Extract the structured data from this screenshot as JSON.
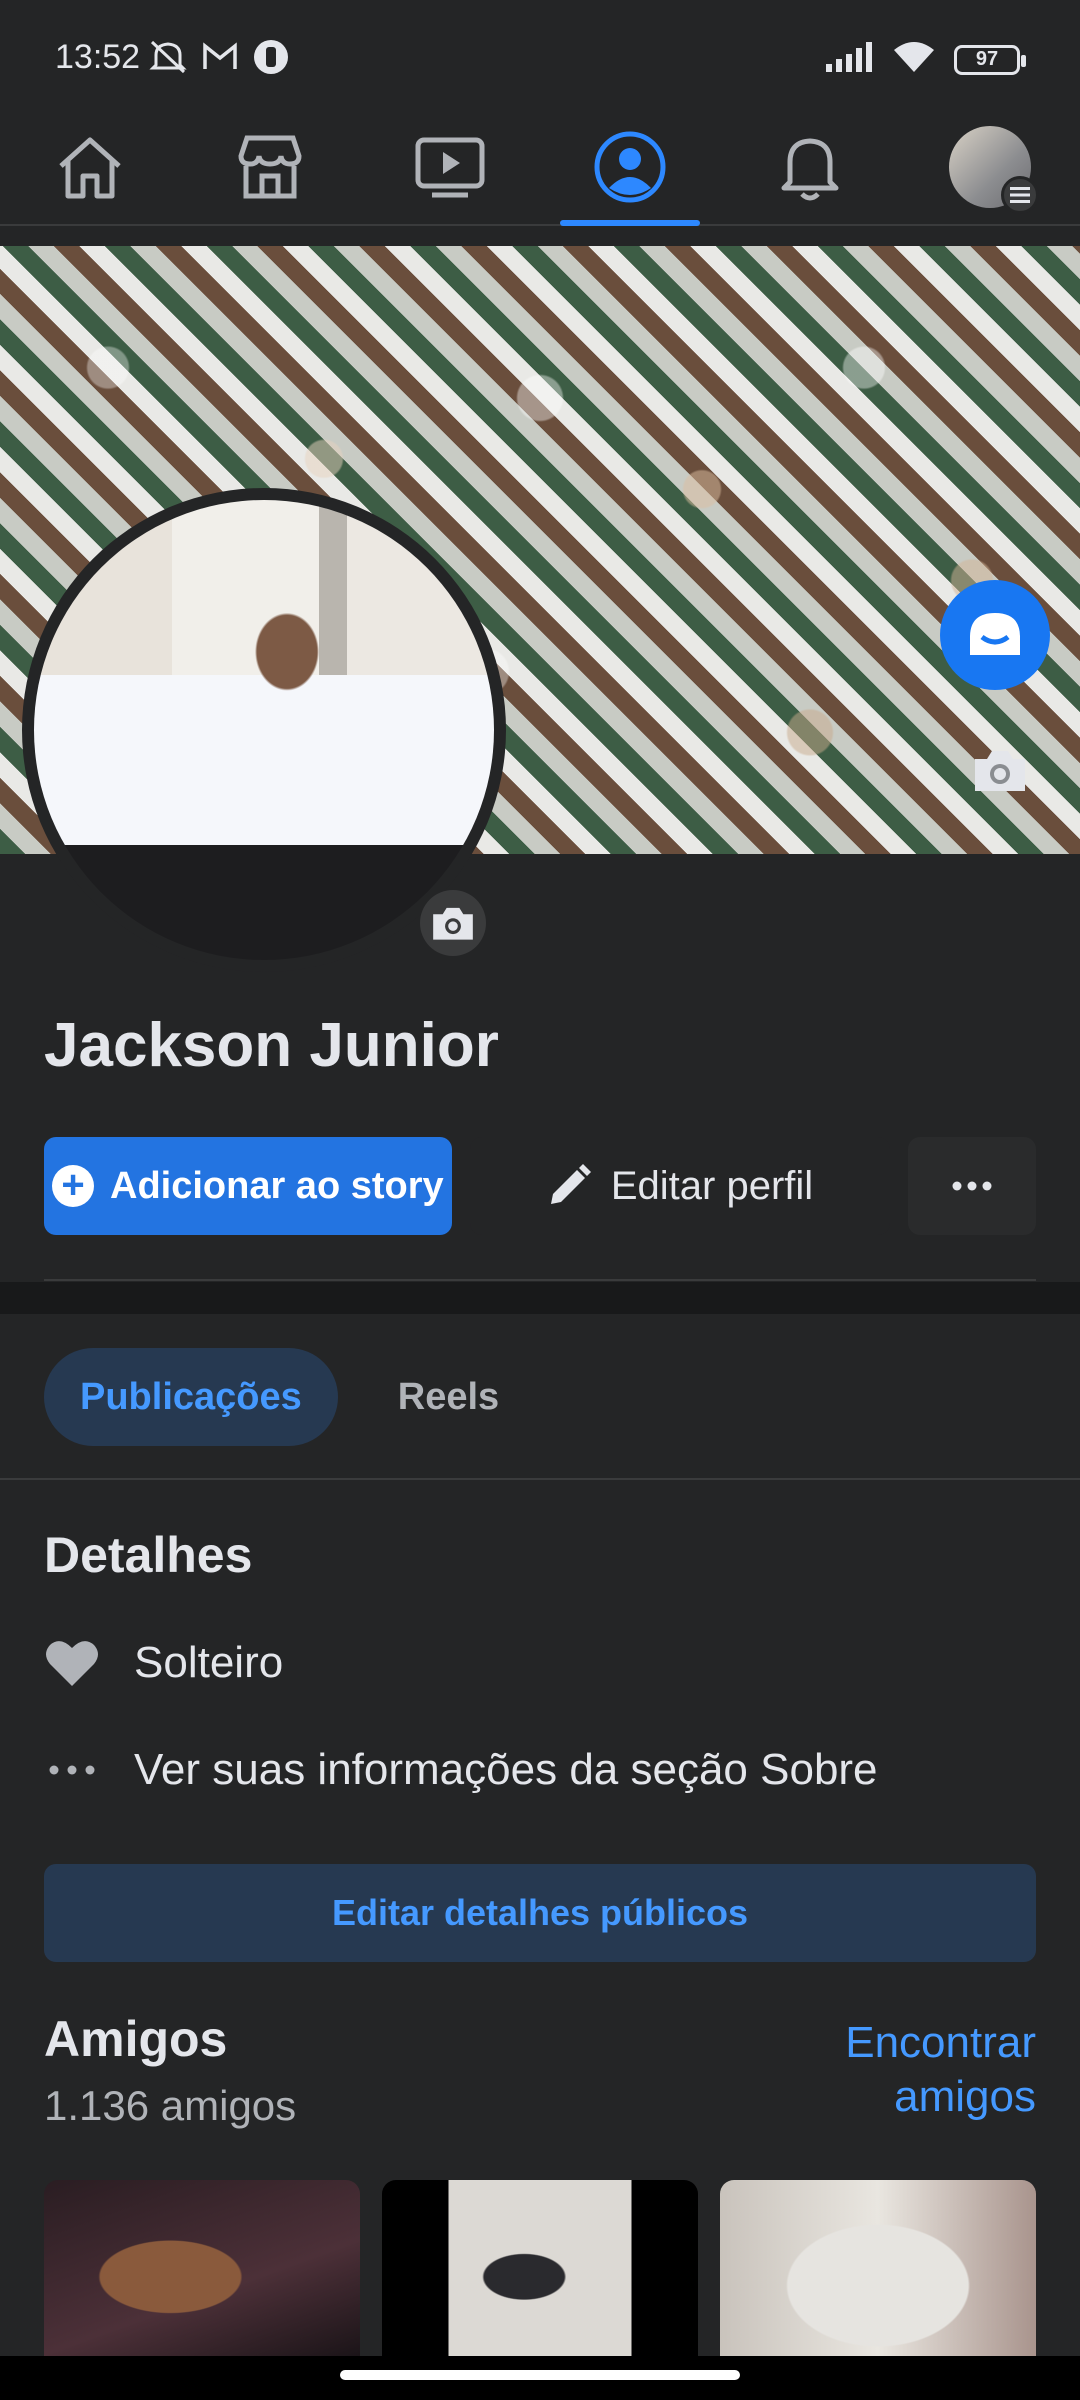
{
  "status_bar": {
    "time": "13:52",
    "battery": "97",
    "icons_left": [
      "mute-icon",
      "gmail-icon",
      "app-icon"
    ],
    "icons_right": [
      "signal-icon",
      "wifi-icon",
      "battery-icon"
    ]
  },
  "nav": {
    "items": [
      {
        "name": "home",
        "icon": "home-icon"
      },
      {
        "name": "marketplace",
        "icon": "store-icon"
      },
      {
        "name": "watch",
        "icon": "video-icon"
      },
      {
        "name": "profile",
        "icon": "profile-icon",
        "active": true
      },
      {
        "name": "notifications",
        "icon": "bell-icon"
      },
      {
        "name": "menu",
        "icon": "avatar-menu-icon"
      }
    ]
  },
  "colors": {
    "background": "#242526",
    "accent": "#2374e1",
    "link": "#4599ff",
    "text": "#e4e6eb",
    "muted": "#b0b3b8"
  },
  "profile": {
    "name": "Jackson Junior"
  },
  "actions": {
    "add_story": "Adicionar ao story",
    "edit_profile": "Editar perfil",
    "more": "•••"
  },
  "tabs": {
    "posts": "Publicações",
    "reels": "Reels"
  },
  "details": {
    "title": "Detalhes",
    "relationship": "Solteiro",
    "about_link": "Ver suas informações da seção Sobre",
    "edit_public": "Editar detalhes públicos"
  },
  "friends": {
    "title": "Amigos",
    "count": "1.136 amigos",
    "find_line1": "Encontrar",
    "find_line2": "amigos"
  }
}
